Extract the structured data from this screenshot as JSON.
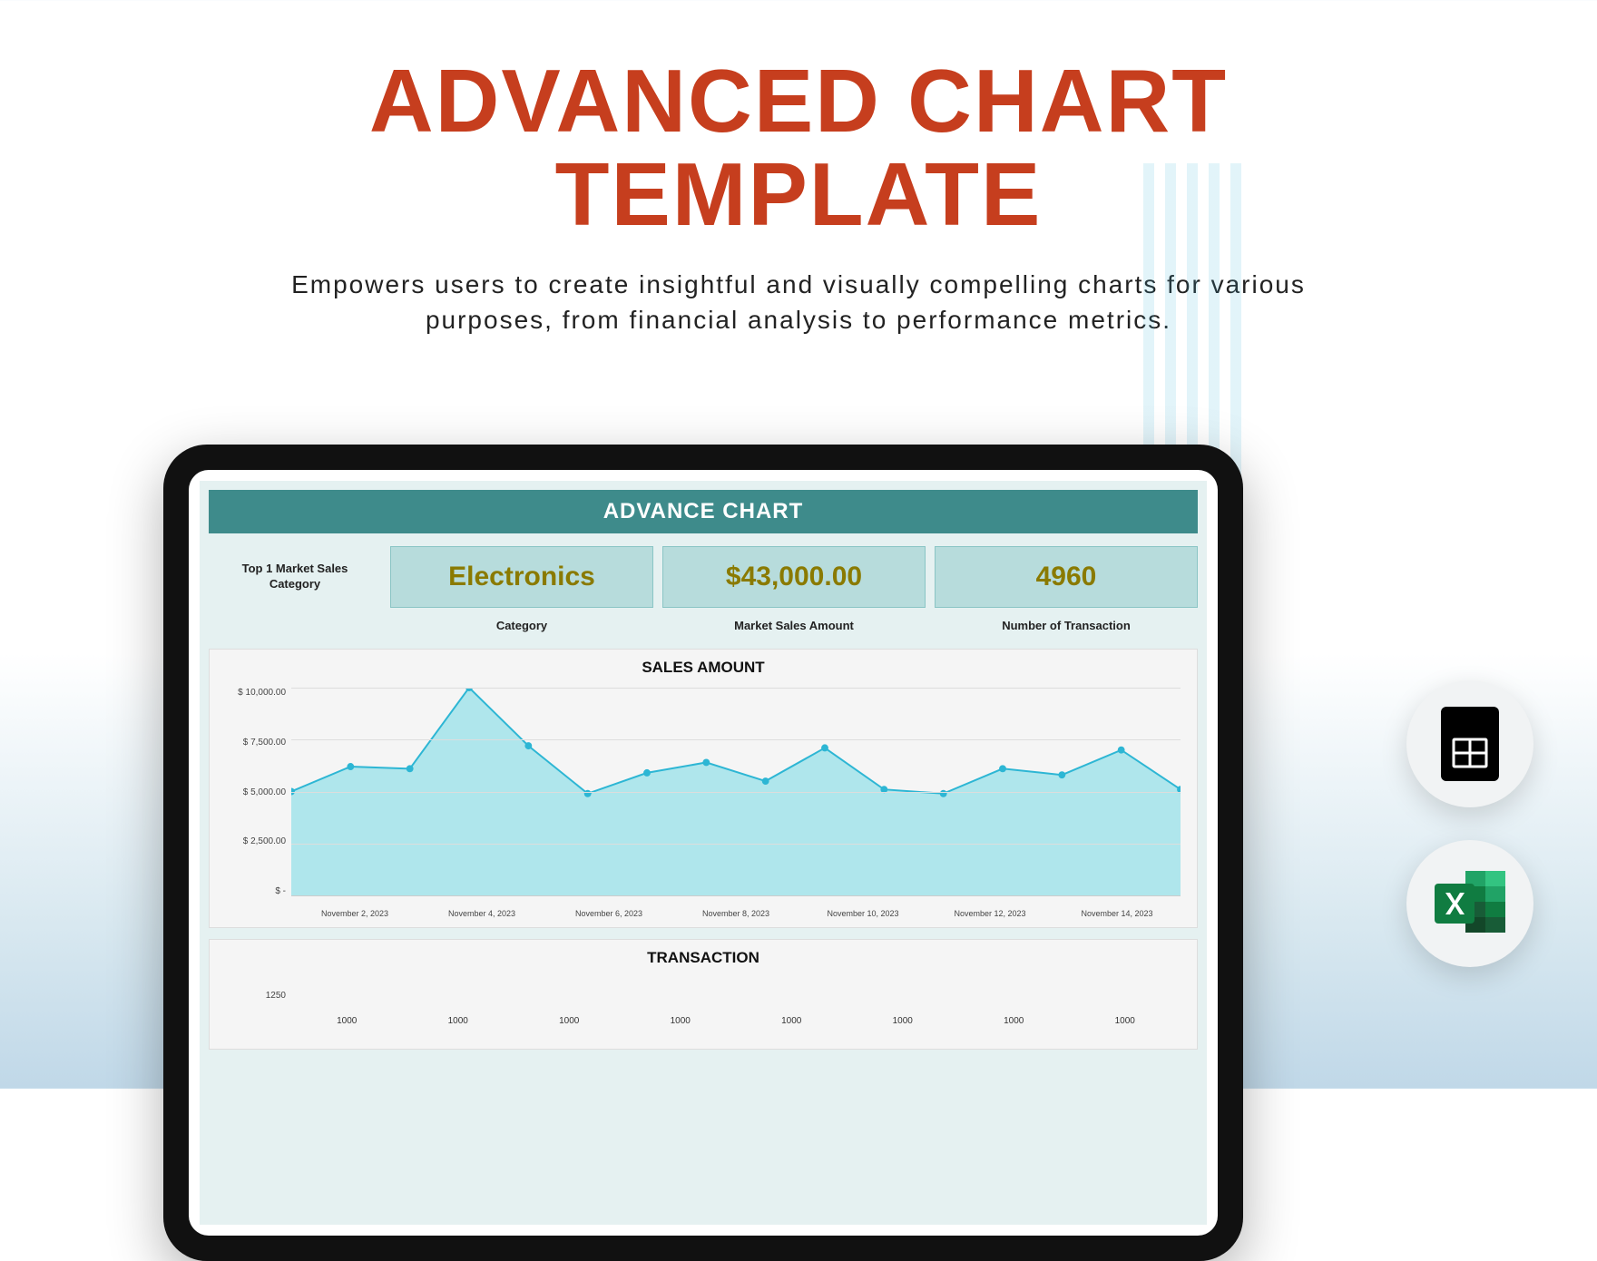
{
  "hero": {
    "title_line1": "ADVANCED CHART",
    "title_line2": "TEMPLATE",
    "subtitle": "Empowers users to create insightful and visually compelling charts for various purposes, from financial analysis to performance metrics."
  },
  "dashboard": {
    "banner": "ADVANCE CHART",
    "kpi_row_label": "Top 1 Market Sales Category",
    "kpis": [
      {
        "value": "Electronics",
        "label": "Category"
      },
      {
        "value": "$43,000.00",
        "label": "Market Sales Amount"
      },
      {
        "value": "4960",
        "label": "Number of Transaction"
      }
    ]
  },
  "chart_data": [
    {
      "type": "area",
      "title": "SALES AMOUNT",
      "ylabel": "",
      "xlabel": "",
      "ylim": [
        0,
        10000
      ],
      "y_ticks": [
        "$ 10,000.00",
        "$ 7,500.00",
        "$ 5,000.00",
        "$ 2,500.00",
        "$ -"
      ],
      "x_ticks": [
        "November 2, 2023",
        "November 4, 2023",
        "November 6, 2023",
        "November 8, 2023",
        "November 10, 2023",
        "November 12, 2023",
        "November 14, 2023"
      ],
      "values": [
        5000,
        6200,
        6100,
        10000,
        7200,
        4900,
        5900,
        6400,
        5500,
        7100,
        5100,
        4900,
        6100,
        5800,
        7000,
        5100
      ]
    },
    {
      "type": "bar",
      "title": "TRANSACTION",
      "ylabel": "",
      "xlabel": "",
      "ylim": [
        0,
        1250
      ],
      "y_ticks": [
        "1250"
      ],
      "categories": [],
      "values": [
        1000,
        1000,
        1000,
        1000,
        1000,
        1000,
        1000,
        1000
      ]
    }
  ],
  "badges": {
    "sheets": "google-sheets-icon",
    "excel": "microsoft-excel-icon"
  }
}
